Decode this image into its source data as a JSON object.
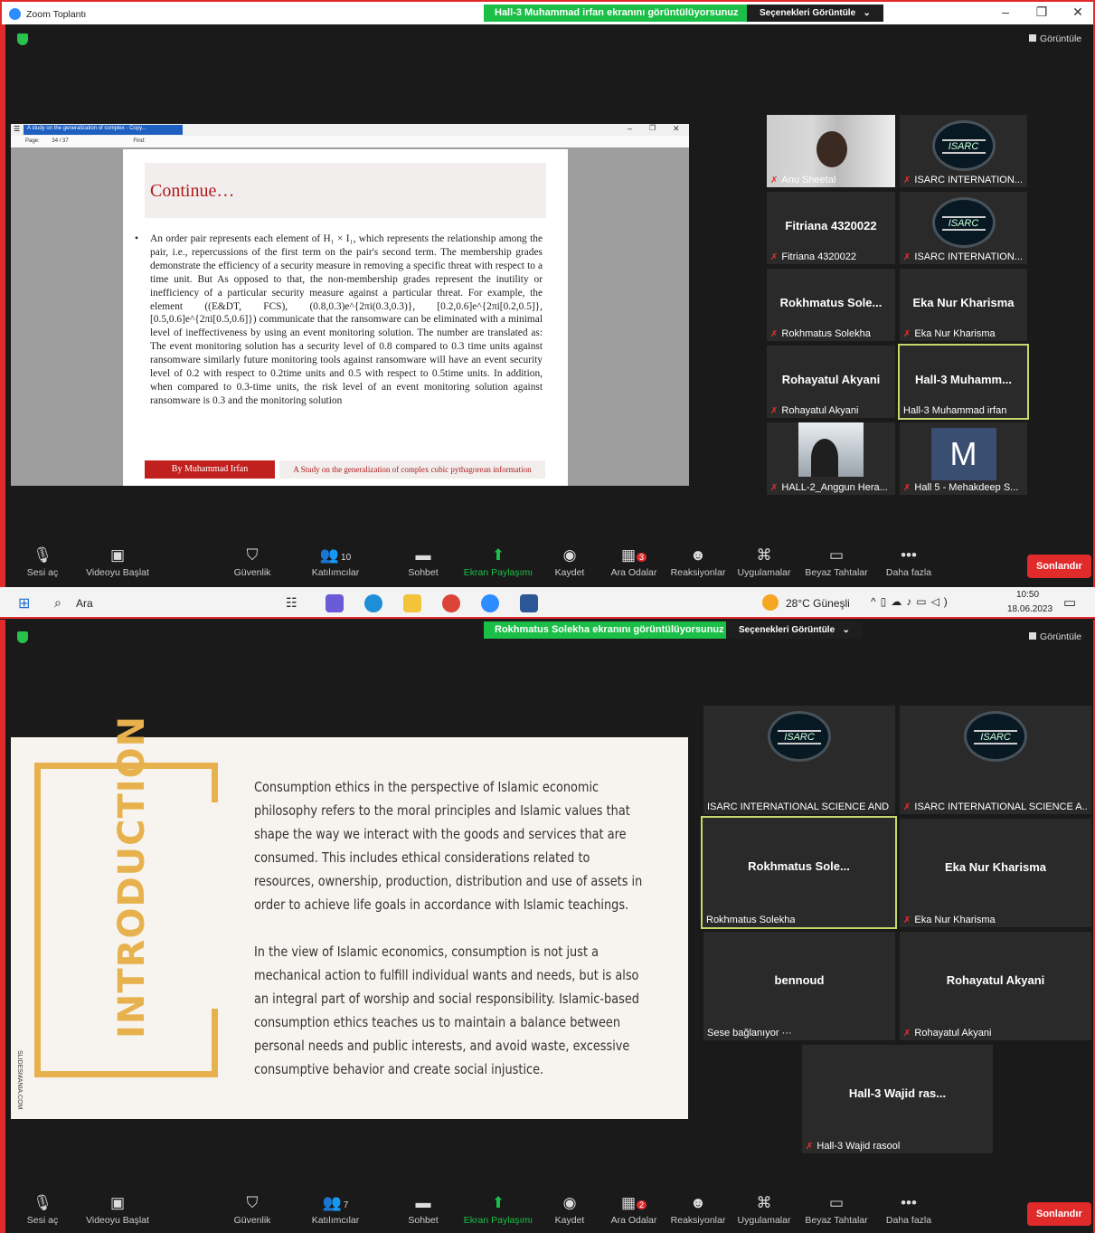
{
  "s1": {
    "window_title": "Zoom Toplantı",
    "share_banner": "Hall-3 Muhammad irfan ekranını görüntülüyorsunuz",
    "options_label": "Seçenekleri Görüntüle",
    "gallery_label": "Görüntüle",
    "pdf": {
      "tab": "A study on the generalization of complex - Copy...",
      "page_label": "Page:",
      "page_current": "34",
      "page_total": "/ 37",
      "find_label": "Find:",
      "slide_title": "Continue…",
      "paragraph": "An order pair represents each element of H₁ × I₁, which represents the relationship among the pair, i.e., repercussions of the first term on the pair's second term. The membership grades demonstrate the efficiency of a security measure in removing a specific threat with respect to a time unit. But As opposed to that, the non-membership grades represent the inutility or inefficiency of a particular security measure against a particular threat. For example, the element ((E&DT, FCS), (0.8,0.3)e^{2πi(0.3,0.3)}, [0.2,0.6]e^{2πi[0.2,0.5]}, [0.5,0.6]e^{2πi[0.5,0.6]}) communicate that the ransomware can be eliminated with a minimal level of ineffectiveness by using an event monitoring solution. The number are translated as: The event monitoring solution has a security level of 0.8 compared to 0.3 time units against ransomware similarly future monitoring tools against ransomware will have an event security level of 0.2 with respect to 0.2time units and 0.5 with respect to 0.5time units. In addition, when compared to 0.3-time units, the risk level of an event monitoring solution against ransomware is 0.3 and the monitoring solution",
      "footer_author": "By Muhammad Irfan",
      "footer_title": "A Study on the generalization of complex cubic pythagorean information"
    },
    "tiles": [
      {
        "name": "",
        "label": "Anu Sheetal",
        "kind": "photo1",
        "muted": true
      },
      {
        "name": "",
        "label": "ISARC INTERNATION...",
        "kind": "isarc",
        "muted": true
      },
      {
        "name": "Fitriana 4320022",
        "label": "Fitriana 4320022",
        "kind": "name",
        "muted": true
      },
      {
        "name": "",
        "label": "ISARC INTERNATION...",
        "kind": "isarc",
        "muted": true
      },
      {
        "name": "Rokhmatus  Sole...",
        "label": "Rokhmatus Solekha",
        "kind": "name",
        "muted": true
      },
      {
        "name": "Eka Nur Kharisma",
        "label": "Eka Nur Kharisma",
        "kind": "name",
        "muted": true
      },
      {
        "name": "Rohayatul Akyani",
        "label": "Rohayatul Akyani",
        "kind": "name",
        "muted": true
      },
      {
        "name": "Hall-3  Muhamm...",
        "label": "Hall-3 Muhammad irfan",
        "kind": "name",
        "muted": false,
        "selected": true
      },
      {
        "name": "",
        "label": "HALL-2_Anggun Hera...",
        "kind": "photo2",
        "muted": true
      },
      {
        "name": "M",
        "label": "Hall 5 - Mehakdeep S...",
        "kind": "avatar",
        "muted": true
      }
    ],
    "toolbar": {
      "participants": "10",
      "rooms_badge": "3"
    }
  },
  "s2": {
    "share_banner": "Rokhmatus Solekha ekranını görüntülüyorsunuz",
    "options_label": "Seçenekleri Görüntüle",
    "gallery_label": "Görüntüle",
    "slide": {
      "vertical_title": "INTRODUCTION",
      "p1": "Consumption ethics in the perspective of Islamic economic philosophy refers to the moral principles and Islamic values that shape the way we interact with the goods and services that are consumed. This includes ethical considerations related to resources, ownership, production, distribution and use of assets in order to achieve life goals in accordance with Islamic teachings.",
      "p2": "In the view of Islamic economics, consumption is not just a mechanical action to fulfill individual wants and needs, but is also an integral part of worship and social responsibility. Islamic-based consumption ethics teaches us to maintain a balance between personal needs and public interests, and avoid waste, excessive consumptive behavior and create social injustice.",
      "credit": "SLIDESMANIA.COM"
    },
    "tiles": [
      {
        "name": "",
        "label": "ISARC INTERNATIONAL SCIENCE AND ...",
        "kind": "isarc",
        "muted": false
      },
      {
        "name": "",
        "label": "ISARC INTERNATIONAL SCIENCE A...",
        "kind": "isarc",
        "muted": true
      },
      {
        "name": "Rokhmatus  Sole...",
        "label": "Rokhmatus Solekha",
        "kind": "name",
        "muted": false,
        "selected": true
      },
      {
        "name": "Eka Nur Kharisma",
        "label": "Eka Nur Kharisma",
        "kind": "name",
        "muted": true
      },
      {
        "name": "bennoud",
        "label": "Sese bağlanıyor ···",
        "kind": "name",
        "muted": false
      },
      {
        "name": "Rohayatul Akyani",
        "label": "Rohayatul Akyani",
        "kind": "name",
        "muted": true
      },
      {
        "name": "Hall-3 Wajid ras...",
        "label": "Hall-3 Wajid rasool",
        "kind": "name",
        "muted": true
      }
    ],
    "toolbar": {
      "participants": "7",
      "rooms_badge": "2"
    }
  },
  "toolbar_labels": {
    "unmute": "Sesi aç",
    "video": "Videoyu Başlat",
    "security": "Güvenlik",
    "participants": "Katılımcılar",
    "chat": "Sohbet",
    "share": "Ekran Paylaşımı",
    "record": "Kaydet",
    "rooms": "Ara Odalar",
    "reactions": "Reaksiyonlar",
    "apps": "Uygulamalar",
    "whiteboard": "Beyaz Tahtalar",
    "more": "Daha fazla",
    "end": "Sonlandır"
  },
  "taskbar": {
    "search": "Ara",
    "weather": "28°C  Güneşli",
    "time": "10:50",
    "date": "18.06.2023"
  },
  "colors": {
    "share_green": "#1bbf48",
    "end_red": "#e12b2b",
    "selected_border": "#c7d86b",
    "slide_accent": "#e7b24d",
    "pdf_red": "#b01b1b"
  }
}
